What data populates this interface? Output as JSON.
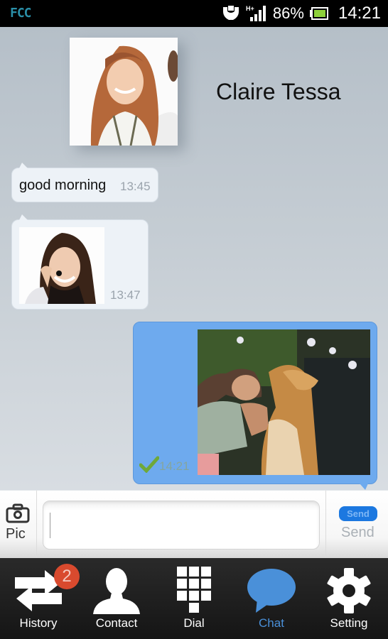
{
  "status_bar": {
    "carrier_logo": "FCC",
    "notification_icon": "hands-icon",
    "network_type": "H+",
    "battery_percent": "86%",
    "time": "14:21"
  },
  "conversation": {
    "contact_name": "Claire Tessa",
    "messages": [
      {
        "direction": "incoming",
        "type": "text",
        "text": "good morning",
        "time": "13:45"
      },
      {
        "direction": "incoming",
        "type": "image",
        "image_desc": "woman with headset",
        "time": "13:47"
      },
      {
        "direction": "outgoing",
        "type": "image",
        "image_desc": "man with dog",
        "time": "14:21",
        "status": "delivered"
      }
    ]
  },
  "input_bar": {
    "pic_label": "Pic",
    "message_value": "",
    "message_placeholder": "",
    "send_pill_label": "Send",
    "send_label": "Send"
  },
  "nav": {
    "items": [
      {
        "label": "History",
        "icon": "history-arrows-icon",
        "badge": "2"
      },
      {
        "label": "Contact",
        "icon": "person-icon"
      },
      {
        "label": "Dial",
        "icon": "dialpad-icon"
      },
      {
        "label": "Chat",
        "icon": "chat-bubble-icon",
        "active": true
      },
      {
        "label": "Setting",
        "icon": "gear-icon"
      }
    ]
  },
  "colors": {
    "accent": "#4a90d9",
    "outgoing_bubble": "#6eaaee",
    "incoming_bubble": "#edf2f7",
    "badge": "#d94a2e"
  }
}
